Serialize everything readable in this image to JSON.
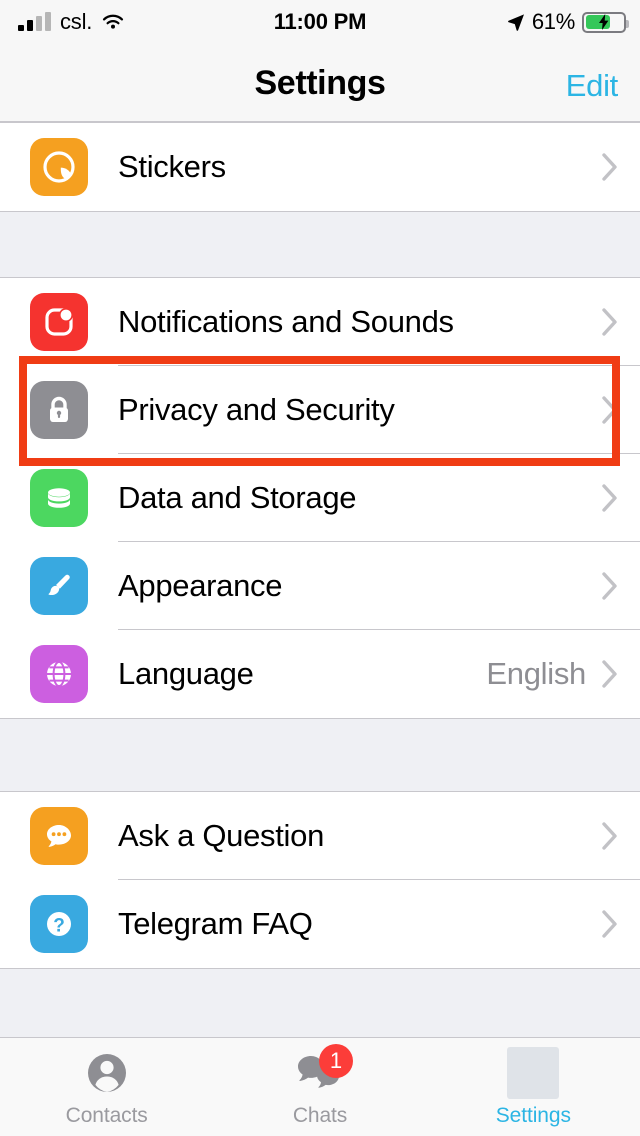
{
  "status_bar": {
    "carrier": "csl.",
    "time": "11:00 PM",
    "battery_percent": "61%",
    "signal_icon": "cellular-signal-icon",
    "wifi_icon": "wifi-icon",
    "location_icon": "location-arrow-icon",
    "battery_icon": "battery-charging-icon",
    "battery_level": 61,
    "charging": true
  },
  "nav": {
    "title": "Settings",
    "edit_label": "Edit",
    "accent_color": "#2cb5e4"
  },
  "sections": [
    {
      "rows": [
        {
          "label": "Stickers",
          "icon": "stickers-icon",
          "icon_color": "#f5a020",
          "value": "",
          "chevron": true
        }
      ]
    },
    {
      "rows": [
        {
          "label": "Notifications and Sounds",
          "icon": "notifications-icon",
          "icon_color": "#f5332f",
          "value": "",
          "chevron": true
        },
        {
          "label": "Privacy and Security",
          "icon": "lock-icon",
          "icon_color": "#8e8e93",
          "value": "",
          "chevron": true
        },
        {
          "label": "Data and Storage",
          "icon": "database-icon",
          "icon_color": "#4cd760",
          "value": "",
          "chevron": true
        },
        {
          "label": "Appearance",
          "icon": "paintbrush-icon",
          "icon_color": "#39a9e0",
          "value": "",
          "chevron": true
        },
        {
          "label": "Language",
          "icon": "globe-icon",
          "icon_color": "#cc5fe0",
          "value": "English",
          "chevron": true
        }
      ]
    },
    {
      "rows": [
        {
          "label": "Ask a Question",
          "icon": "chat-bubble-icon",
          "icon_color": "#f5a020",
          "value": "",
          "chevron": true
        },
        {
          "label": "Telegram FAQ",
          "icon": "question-mark-icon",
          "icon_color": "#39a9e0",
          "value": "",
          "chevron": true
        }
      ]
    }
  ],
  "annotation": {
    "target": "Privacy and Security",
    "color": "#f03c14",
    "shape": "rectangle-highlight"
  },
  "tab_bar": {
    "items": [
      {
        "label": "Contacts",
        "icon": "person-icon",
        "active": false,
        "badge": ""
      },
      {
        "label": "Chats",
        "icon": "chats-bubbles-icon",
        "active": false,
        "badge": "1"
      },
      {
        "label": "Settings",
        "icon": "settings-placeholder-icon",
        "active": true,
        "badge": ""
      }
    ]
  }
}
